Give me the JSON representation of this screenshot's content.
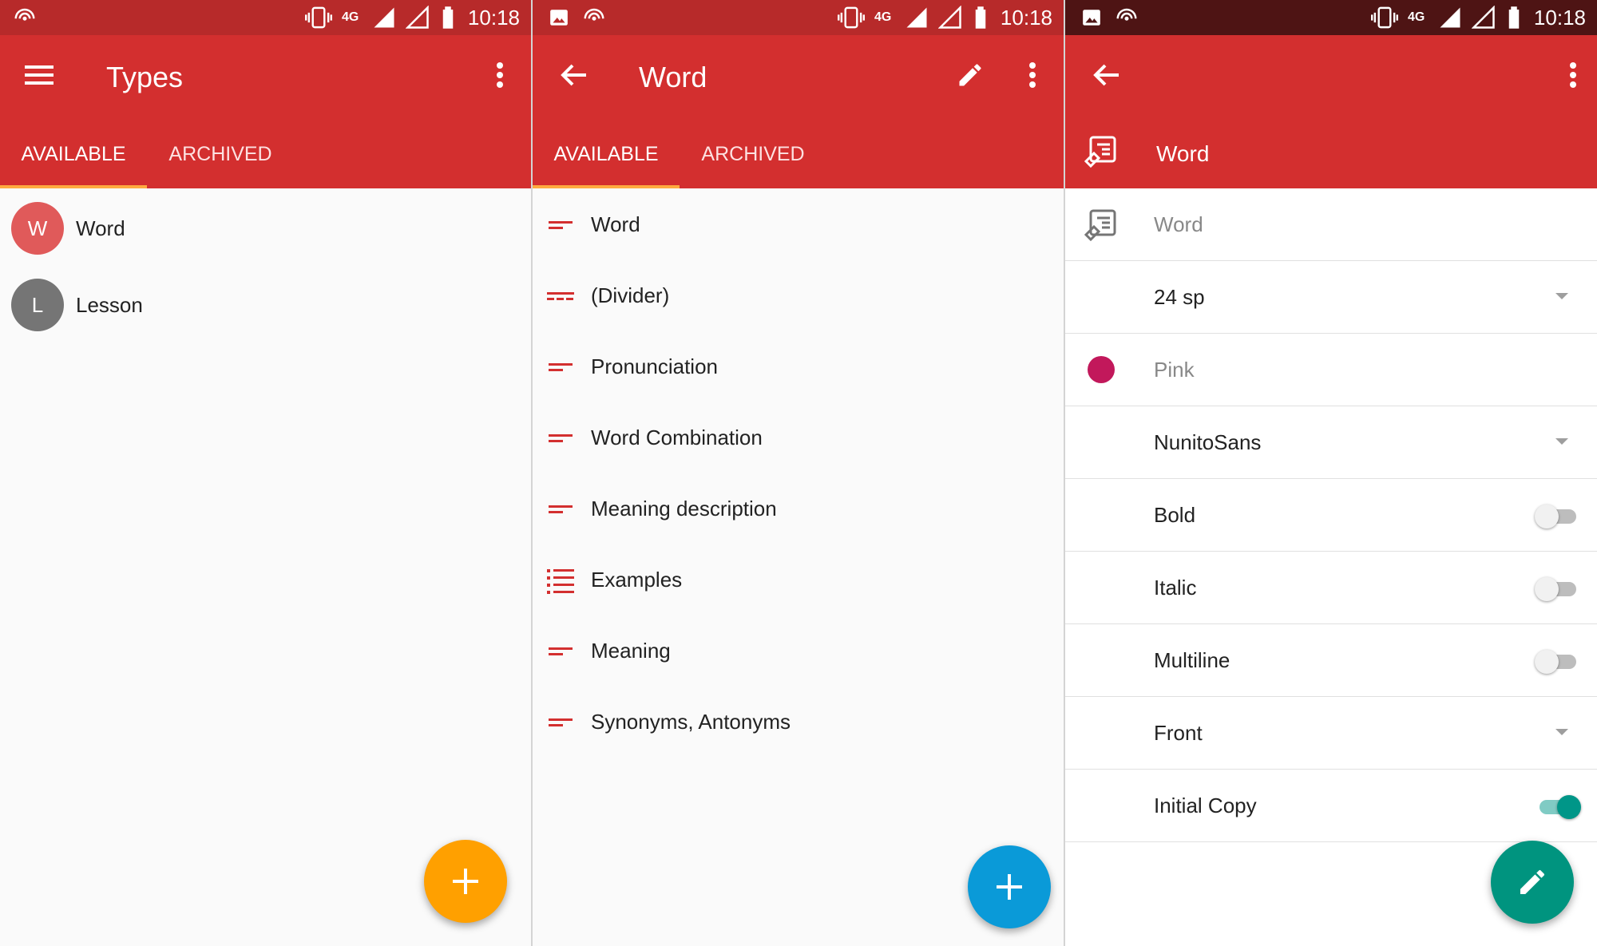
{
  "status": {
    "time": "10:18",
    "network": "4G"
  },
  "screen1": {
    "title": "Types",
    "tabs": [
      "AVAILABLE",
      "ARCHIVED"
    ],
    "items": [
      {
        "letter": "W",
        "label": "Word",
        "color": "#e05a5a"
      },
      {
        "letter": "L",
        "label": "Lesson",
        "color": "#757575"
      }
    ],
    "fab_color": "#ffa000"
  },
  "screen2": {
    "title": "Word",
    "tabs": [
      "AVAILABLE",
      "ARCHIVED"
    ],
    "fields": [
      {
        "label": "Word",
        "icon": "short-text-icon"
      },
      {
        "label": "(Divider)",
        "icon": "dashed-line-icon"
      },
      {
        "label": "Pronunciation",
        "icon": "short-text-icon"
      },
      {
        "label": "Word Combination",
        "icon": "short-text-icon"
      },
      {
        "label": "Meaning description",
        "icon": "short-text-icon"
      },
      {
        "label": "Examples",
        "icon": "list-icon"
      },
      {
        "label": "Meaning",
        "icon": "short-text-icon"
      },
      {
        "label": "Synonyms, Antonyms",
        "icon": "short-text-icon"
      }
    ],
    "fab_color": "#0a9ad8"
  },
  "screen3": {
    "header_name": "Word",
    "name_value": "Word",
    "size": "24 sp",
    "color_name": "Pink",
    "color_hex": "#c2185b",
    "font": "NunitoSans",
    "bold_label": "Bold",
    "bold_on": false,
    "italic_label": "Italic",
    "italic_on": false,
    "multiline_label": "Multiline",
    "multiline_on": false,
    "side": "Front",
    "initial_copy_label": "Initial Copy",
    "initial_copy_on": true,
    "fab_color": "#00947f"
  },
  "colors": {
    "primary": "#d32f2f",
    "status": "#b72a2a",
    "accent_indicator": "#ffab40"
  }
}
